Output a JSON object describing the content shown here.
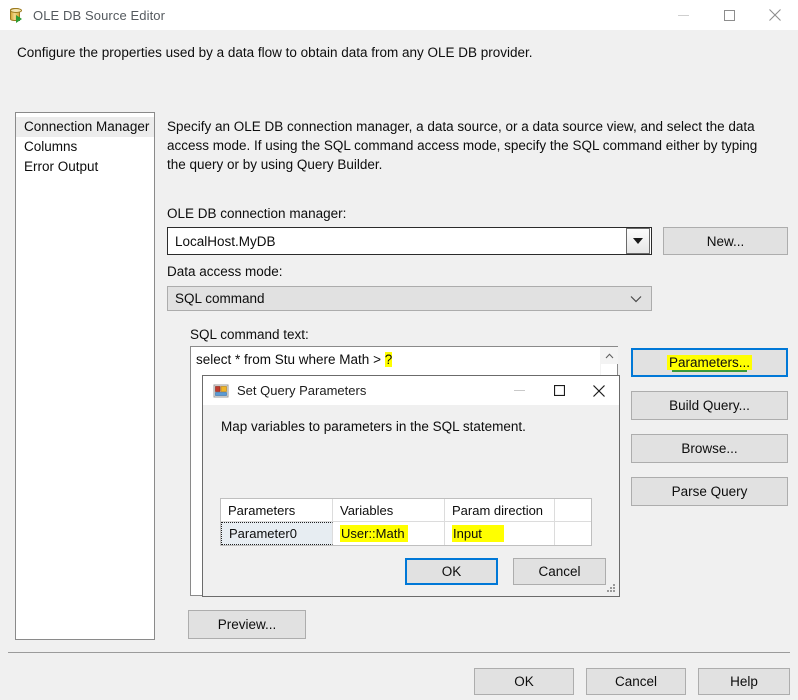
{
  "window": {
    "title": "OLE DB Source Editor",
    "icon": "database-source-icon",
    "minimize_icon": "minimize-icon",
    "maximize_icon": "maximize-icon",
    "close_icon": "close-icon"
  },
  "header": {
    "description": "Configure the properties used by a data flow to obtain data from any OLE DB provider."
  },
  "sidebar": {
    "items": [
      {
        "label": "Connection Manager",
        "selected": true
      },
      {
        "label": "Columns",
        "selected": false
      },
      {
        "label": "Error Output",
        "selected": false
      }
    ]
  },
  "main": {
    "description": "Specify an OLE DB connection manager, a data source, or a data source view, and select the data access mode. If using the SQL command access mode, specify the SQL command either by typing the query or by using Query Builder.",
    "connection_manager": {
      "label": "OLE DB connection manager:",
      "value": "LocalHost.MyDB",
      "dropdown_icon": "triangle-down-icon",
      "new_button": "New..."
    },
    "data_access_mode": {
      "label": "Data access mode:",
      "value": "SQL command",
      "dropdown_icon": "chevron-down-icon"
    },
    "sql_command": {
      "label": "SQL command text:",
      "text_before": "select * from Stu where Math > ",
      "highlighted_token": "?",
      "scroll_up_icon": "scroll-up-arrow-icon"
    },
    "action_buttons": [
      {
        "label": "Parameters...",
        "focused": true,
        "highlighted": true
      },
      {
        "label": "Build Query...",
        "focused": false,
        "highlighted": false
      },
      {
        "label": "Browse...",
        "focused": false,
        "highlighted": false
      },
      {
        "label": "Parse Query",
        "focused": false,
        "highlighted": false
      }
    ],
    "preview_button": "Preview..."
  },
  "footer": {
    "ok": "OK",
    "cancel": "Cancel",
    "help": "Help"
  },
  "dialog": {
    "title": "Set Query Parameters",
    "icon": "windows-form-icon",
    "minimize_icon": "minimize-icon",
    "maximize_icon": "maximize-icon",
    "close_icon": "close-icon",
    "subtitle": "Map variables to parameters in the SQL statement.",
    "grid": {
      "columns": [
        "Parameters",
        "Variables",
        "Param direction",
        ""
      ],
      "rows": [
        {
          "parameter": "Parameter0",
          "variable": "User::Math",
          "direction": "Input",
          "extra": "",
          "selected": true,
          "variable_highlighted": true,
          "direction_highlighted": true
        }
      ]
    },
    "ok": "OK",
    "cancel": "Cancel",
    "resize_grip_icon": "resize-grip-icon"
  },
  "colors": {
    "window_background": "#f0f0f0",
    "titlebar": "#ffffff",
    "focus_blue": "#0078d7",
    "highlight_yellow": "#ffff00",
    "button_face": "#e1e1e1",
    "selected_row": "#e7edf2",
    "annotation_green": "#3a9a38"
  }
}
